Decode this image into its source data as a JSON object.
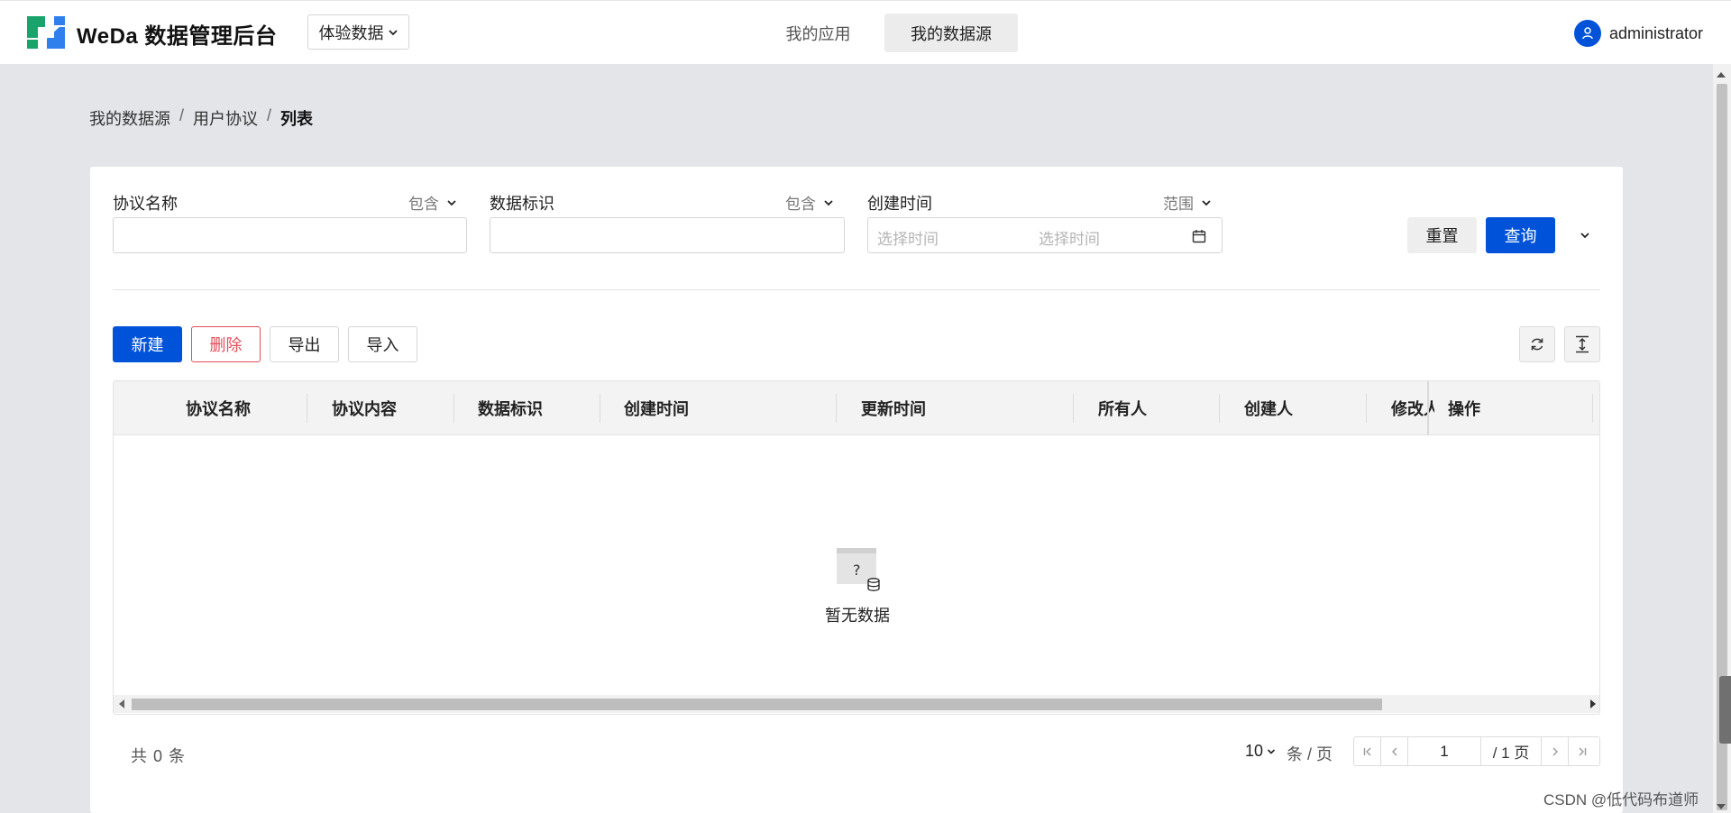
{
  "header": {
    "brand": "WeDa 数据管理后台",
    "env_select": "体验数据",
    "nav": [
      {
        "label": "我的应用",
        "active": false
      },
      {
        "label": "我的数据源",
        "active": true
      }
    ],
    "user": "administrator"
  },
  "breadcrumb": {
    "items": [
      "我的数据源",
      "用户协议",
      "列表"
    ],
    "separator": "/"
  },
  "filters": {
    "name": {
      "label": "协议名称",
      "mode": "包含",
      "value": ""
    },
    "identifier": {
      "label": "数据标识",
      "mode": "包含",
      "value": ""
    },
    "created": {
      "label": "创建时间",
      "mode": "范围",
      "start_placeholder": "选择时间",
      "end_placeholder": "选择时间"
    },
    "reset_label": "重置",
    "query_label": "查询"
  },
  "toolbar": {
    "new_label": "新建",
    "delete_label": "删除",
    "export_label": "导出",
    "import_label": "导入"
  },
  "table": {
    "columns": [
      "协议名称",
      "协议内容",
      "数据标识",
      "创建时间",
      "更新时间",
      "所有人",
      "创建人",
      "修改人",
      "操作"
    ],
    "rows": [],
    "empty_text": "暂无数据"
  },
  "pagination": {
    "total_text": "共 0 条",
    "page_size": "10",
    "page_unit": "条 / 页",
    "current_page": "1",
    "total_pages_text": "/ 1 页"
  },
  "watermark": "CSDN @低代码布道师",
  "colors": {
    "primary": "#0052d9",
    "danger": "#e34d59",
    "background": "#e3e5e9"
  }
}
